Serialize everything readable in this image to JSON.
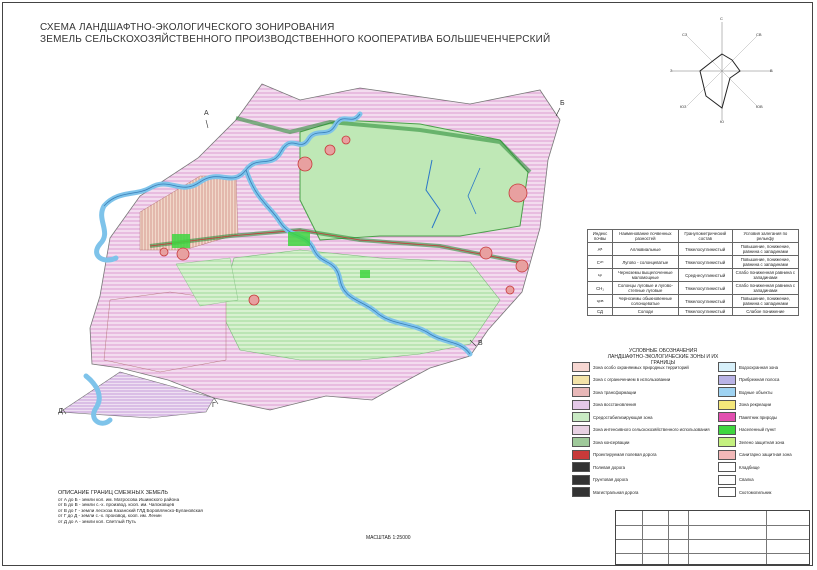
{
  "title": {
    "line1": "СХЕМА ЛАНДШАФТНО-ЭКОЛОГИЧЕСКОГО ЗОНИРОВАНИЯ",
    "line2": "ЗЕМЕЛЬ СЕЛЬСКОХОЗЯЙСТВЕННОГО ПРОИЗВОДСТВЕННОГО КООПЕРАТИВА БОЛЬШЕЧЕНЧЕРСКИЙ"
  },
  "map_letters": [
    "А",
    "Б",
    "В",
    "Г",
    "Д"
  ],
  "wind_rose": {
    "labels": [
      "С",
      "СВ",
      "В",
      "ЮВ",
      "Ю",
      "ЮЗ",
      "З",
      "СЗ"
    ]
  },
  "soil_table": {
    "headers": [
      "Индекс почвы",
      "Наименование почвенных разностей",
      "Гранулометрический состав",
      "Условия залегания по рельефу"
    ],
    "rows": [
      [
        "Aᴮ",
        "Аллювиальные",
        "Тяжелосуглинистый",
        "Повышение, понижение, равнина с западинами"
      ],
      [
        "Cᶜᴴ",
        "Лугово - солонцеватые",
        "Тяжелосуглинистый",
        "Повышение, понижение, равнина с западинами"
      ],
      [
        "Чᶜ",
        "Черноземы выщелоченные маломощные",
        "Среднесуглинистый",
        "Слабо пониженная равнина с западинами"
      ],
      [
        "СН₁",
        "Солонцы луговые и лугово-степные луговые",
        "Тяжелосуглинистый",
        "Слабо пониженная равнина с западинами"
      ],
      [
        "Чᴼᴮ",
        "Черноземы обыкновенные солонцеватые",
        "Тяжелосуглинистый",
        "Повышение, понижение, равнина с западинами"
      ],
      [
        "СД",
        "Солоди",
        "Тяжелосуглинистый",
        "Слабое понижение"
      ]
    ]
  },
  "legend": {
    "heading1": "УСЛОВНЫЕ ОБОЗНАЧЕНИЯ",
    "heading2": "ЛАНДШАФТНО-ЭКОЛОГИЧЕСКИЕ ЗОНЫ И ИХ ГРАНИЦЫ",
    "left": [
      {
        "label": "Зона особо охраняемых природных территорий",
        "color": "#f7d7d2"
      },
      {
        "label": "Зона с ограничением в использовании",
        "color": "#f3e3a8"
      },
      {
        "label": "Зона трансформации",
        "color": "#e8b8b8"
      },
      {
        "label": "Зона восстановления",
        "color": "#e4c9e8"
      },
      {
        "label": "Средостабилизирующая зона",
        "color": "#c9eac4"
      },
      {
        "label": "Зона интенсивного сельскохозяйственного использования",
        "color": "#e8d1e3"
      },
      {
        "label": "Зона консервации",
        "color": "#9fc99a"
      },
      {
        "label": "Проектируемая полевая дорога",
        "color": "#c73a3a"
      },
      {
        "label": "Полевая дорога",
        "color": "#333333"
      },
      {
        "label": "Грунтовая дорога",
        "color": "#333333"
      },
      {
        "label": "Магистральная дорога",
        "color": "#333333"
      }
    ],
    "right": [
      {
        "label": "Водоохранная зона",
        "color": "#d7f0fa"
      },
      {
        "label": "Прибрежная полоса",
        "color": "#b9b3e6"
      },
      {
        "label": "Водные объекты",
        "color": "#9fd3f2"
      },
      {
        "label": "Зона рекреации",
        "color": "#f4e77a"
      },
      {
        "label": "Памятник природы",
        "color": "#e24fb0"
      },
      {
        "label": "Населенный пункт",
        "color": "#3fd63f"
      },
      {
        "label": "Зелено защитная зона",
        "color": "#c4f07f"
      },
      {
        "label": "Санитарно защитная зона",
        "color": "#f2b8b8"
      },
      {
        "label": "Кладбище",
        "color": "#ffffff"
      },
      {
        "label": "Свалка",
        "color": "#ffffff"
      },
      {
        "label": "Скотомогильник",
        "color": "#ffffff"
      }
    ]
  },
  "borders": {
    "heading": "ОПИСАНИЕ ГРАНИЦ СМЕЖНЫХ ЗЕМЕЛЬ",
    "lines": [
      "от А до Б - земли кол. им. Матросова Ишимского района",
      "от Б до В - земли с.-х. производ. кооп. им. Чапоковцев",
      "от В до Г - земли лесхоза Казанский ГЛД Боровлянско-Булановская",
      "от Г до Д - земли с.-х. производ. кооп. им. Ленин",
      "от Д до А - земли кол. Светлый Путь"
    ]
  },
  "scale": "МАСШТАБ 1:25000",
  "colors": {
    "forest": "#9fe09a",
    "field_pink": "#e6b5d8",
    "field_green": "#bfe8b6",
    "river": "#7ec3ea",
    "red_line": "#c73a3a"
  }
}
